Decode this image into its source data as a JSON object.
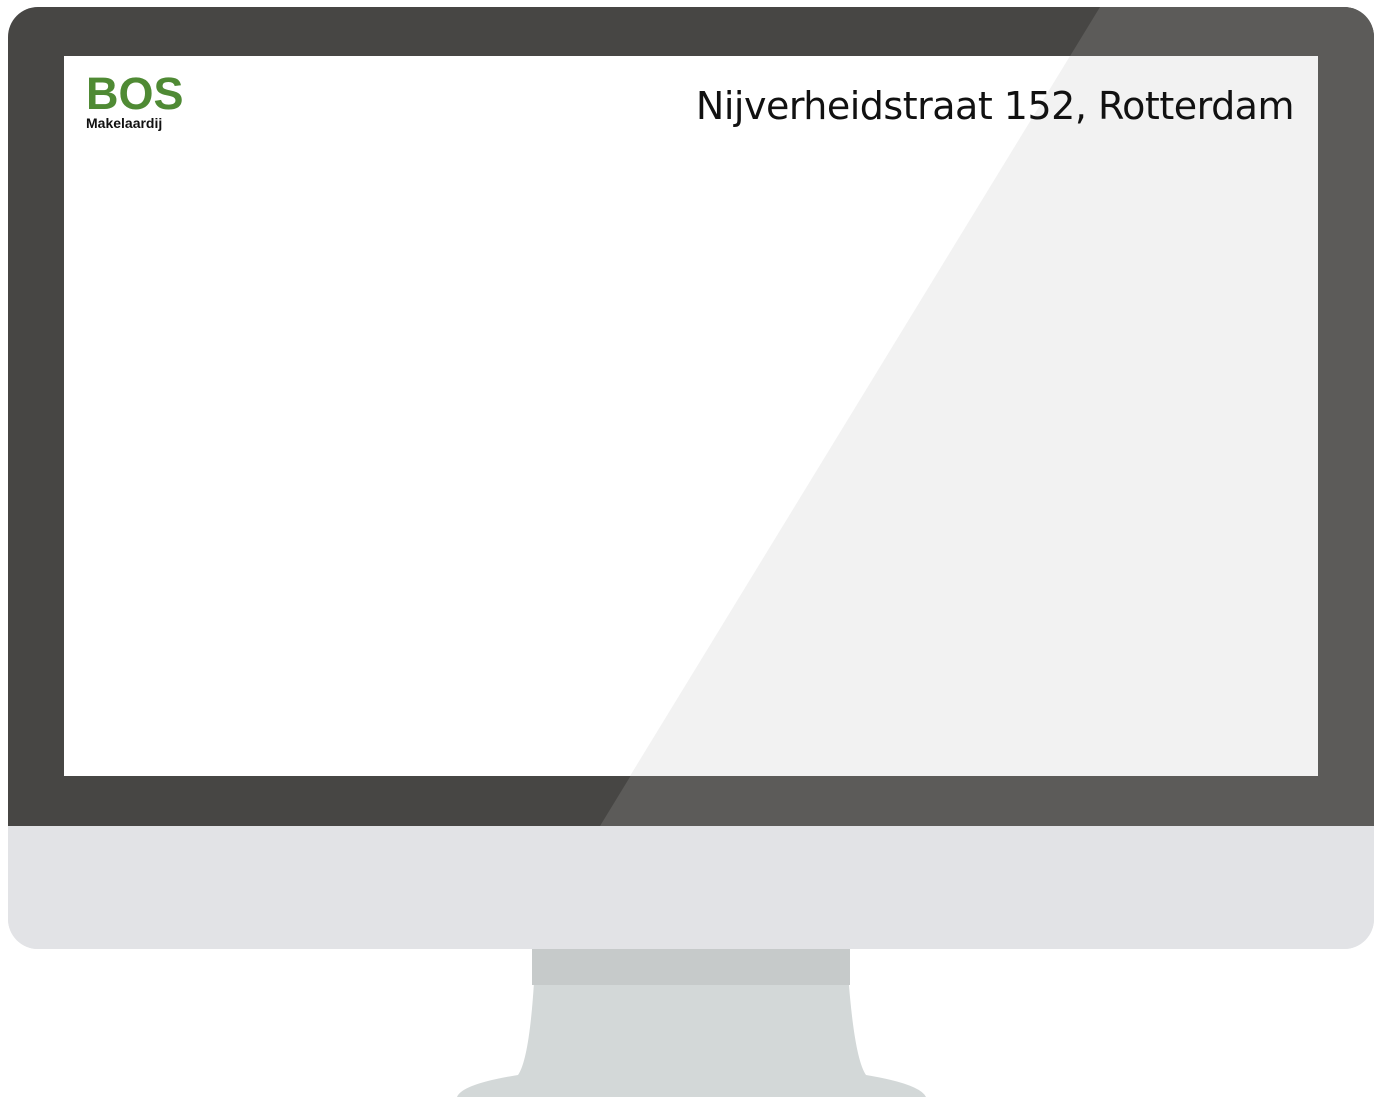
{
  "brand": {
    "name": "BOS",
    "tagline": "Makelaardij",
    "color": "#4f8a34"
  },
  "header": {
    "address": "Nijverheidstraat 152, Rotterdam"
  },
  "colors": {
    "bezel": "#474644",
    "bezel_shine": "#5c5b59",
    "chin": "#e2e3e6",
    "stand": "#d3d8d8",
    "stand_shadow": "#c6caca",
    "screen": "#ffffff",
    "screen_glare": "#f2f2f2"
  }
}
